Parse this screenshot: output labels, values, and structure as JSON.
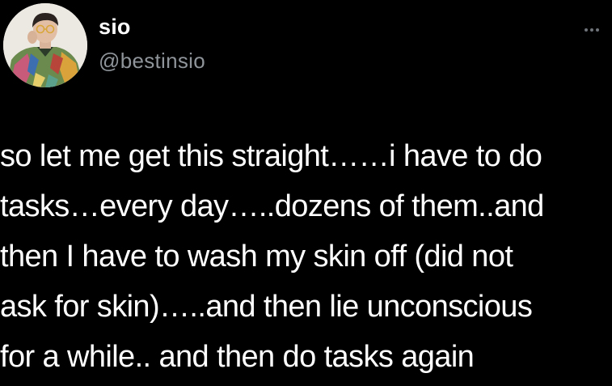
{
  "author": {
    "display_name": "sio",
    "handle": "@bestinsio",
    "avatar_icon": "profile-photo"
  },
  "menu": {
    "icon": "more-horizontal-icon"
  },
  "tweet": {
    "lines": [
      "so let me get this straight……i have to do",
      "tasks…every day…..dozens of them..and",
      "then I have to wash my skin off (did not",
      "ask for skin)…..and then lie unconscious",
      "for a while.. and then do tasks again"
    ]
  },
  "colors": {
    "background": "#000000",
    "text": "#ffffff",
    "secondary_text": "#8e9499"
  }
}
